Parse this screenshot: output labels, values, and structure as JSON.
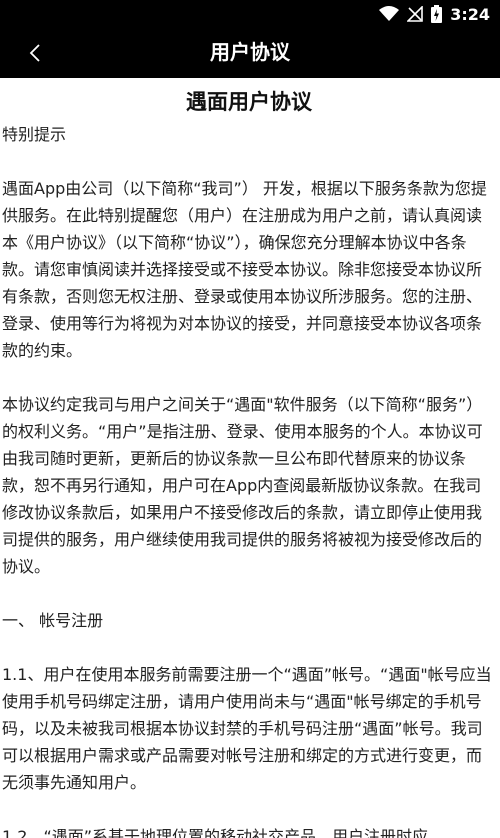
{
  "status_bar": {
    "time": "3:24",
    "icons": [
      "wifi-icon",
      "no-signal-icon",
      "battery-icon"
    ]
  },
  "app_bar": {
    "title": "用户协议",
    "back_icon": "chevron-left-icon"
  },
  "document": {
    "title": "遇面用户协议",
    "notice_heading": "特别提示",
    "paragraphs": [
      "遇面App由公司（以下简称“我司”） 开发，根据以下服务条款为您提供服务。在此特别提醒您（用户）在注册成为用户之前，请认真阅读本《用户协议》（以下简称“协议”），确保您充分理解本协议中各条款。请您审慎阅读并选择接受或不接受本协议。除非您接受本协议所有条款，否则您无权注册、登录或使用本协议所涉服务。您的注册、登录、使用等行为将视为对本协议的接受，并同意接受本协议各项条款的约束。",
      "本协议约定我司与用户之间关于“遇面\"软件服务（以下简称“服务”）的权利义务。“用户”是指注册、登录、使用本服务的个人。本协议可由我司随时更新，更新后的协议条款一旦公布即代替原来的协议条款，恕不再另行通知，用户可在App内查阅最新版协议条款。在我司修改协议条款后，如果用户不接受修改后的条款，请立即停止使用我司提供的服务，用户继续使用我司提供的服务将被视为接受修改后的协议。"
    ],
    "section_1_heading": "一、 帐号注册",
    "clause_1_1": "1.1、用户在使用本服务前需要注册一个“遇面”帐号。“遇面\"帐号应当使用手机号码绑定注册，请用户使用尚未与“遇面\"帐号绑定的手机号码，以及未被我司根据本协议封禁的手机号码注册“遇面”帐号。我司可以根据用户需求或产品需要对帐号注册和绑定的方式进行变更，而无须事先通知用户。",
    "clause_1_2_partial": "1.2、“遇面”系基于地理位置的移动社交产品，用户注册时应"
  }
}
